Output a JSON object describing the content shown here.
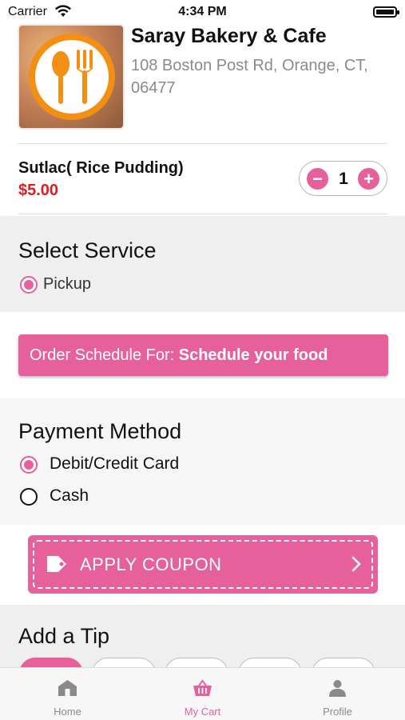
{
  "status_bar": {
    "carrier": "Carrier",
    "time": "4:34 PM"
  },
  "restaurant": {
    "name": "Saray Bakery & Cafe",
    "address": "108 Boston Post Rd, Orange, CT, 06477"
  },
  "cart_item": {
    "name": "Sutlac( Rice Pudding)",
    "price": "$5.00",
    "quantity": "1",
    "minus": "−",
    "plus": "+"
  },
  "service": {
    "title": "Select Service",
    "options": [
      {
        "label": "Pickup",
        "selected": true
      }
    ]
  },
  "schedule": {
    "prefix": "Order Schedule For: ",
    "value": "Schedule your food"
  },
  "payment": {
    "title": "Payment Method",
    "options": [
      {
        "label": "Debit/Credit Card",
        "selected": true
      },
      {
        "label": "Cash",
        "selected": false
      }
    ]
  },
  "coupon": {
    "label": "APPLY COUPON"
  },
  "tip": {
    "title": "Add a Tip"
  },
  "tabbar": {
    "items": [
      {
        "label": "Home",
        "icon": "home-icon",
        "active": false
      },
      {
        "label": "My Cart",
        "icon": "basket-icon",
        "active": true
      },
      {
        "label": "Profile",
        "icon": "person-icon",
        "active": false
      }
    ]
  },
  "colors": {
    "accent": "#e6609c",
    "price": "#e01b24",
    "logo_orange": "#f38f12"
  }
}
